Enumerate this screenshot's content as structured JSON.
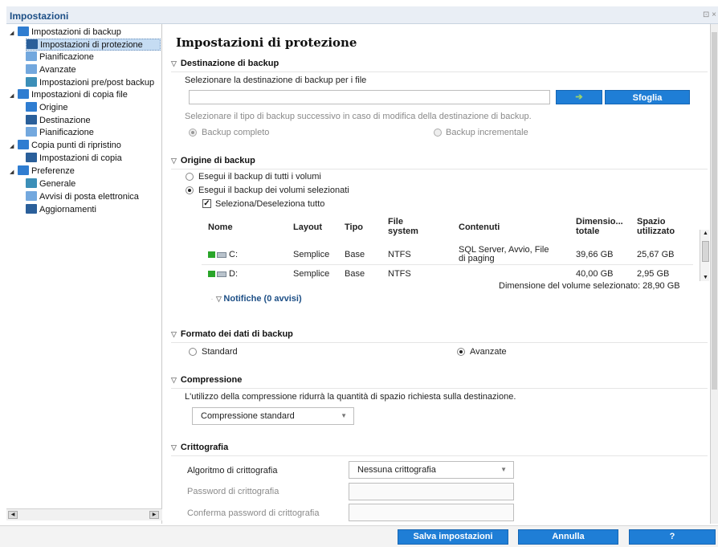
{
  "window": {
    "title": "Impostazioni",
    "controls": "⊡ ×"
  },
  "sidebar": {
    "items": [
      {
        "label": "Impostazioni di backup"
      },
      {
        "label": "Impostazioni di protezione"
      },
      {
        "label": "Pianificazione"
      },
      {
        "label": "Avanzate"
      },
      {
        "label": "Impostazioni pre/post backup"
      },
      {
        "label": "Impostazioni di copia file"
      },
      {
        "label": "Origine"
      },
      {
        "label": "Destinazione"
      },
      {
        "label": "Pianificazione"
      },
      {
        "label": "Copia punti di ripristino"
      },
      {
        "label": "Impostazioni di copia"
      },
      {
        "label": "Preferenze"
      },
      {
        "label": "Generale"
      },
      {
        "label": "Avvisi di posta elettronica"
      },
      {
        "label": "Aggiornamenti"
      }
    ]
  },
  "main": {
    "page_title": "Impostazioni di protezione",
    "destination": {
      "heading": "Destinazione di backup",
      "label": "Selezionare la destinazione di backup per i file",
      "value": "",
      "browse": "Sfoglia",
      "hint": "Selezionare il tipo di backup successivo in caso di modifica della destinazione di backup.",
      "full": "Backup completo",
      "incremental": "Backup incrementale"
    },
    "source": {
      "heading": "Origine di backup",
      "opt_all": "Esegui il backup di tutti i volumi",
      "opt_selected": "Esegui il backup dei volumi selezionati",
      "toggle_all": "Seleziona/Deseleziona tutto",
      "columns": [
        "Nome",
        "Layout",
        "Tipo",
        "File system",
        "Contenuti",
        "Dimensione totale",
        "Spazio utilizzato"
      ],
      "col_labels": {
        "nome": "Nome",
        "layout": "Layout",
        "tipo": "Tipo",
        "fs1": "File",
        "fs2": "system",
        "contenuti": "Contenuti",
        "dim1": "Dimensio...",
        "dim2": "totale",
        "spazio1": "Spazio",
        "spazio2": "utilizzato"
      },
      "rows": [
        {
          "name": "C:",
          "layout": "Semplice",
          "type": "Base",
          "fs": "NTFS",
          "content1": "SQL Server, Avvio, File",
          "content2": "di paging",
          "total": "39,66 GB",
          "used": "25,67 GB"
        },
        {
          "name": "D:",
          "layout": "Semplice",
          "type": "Base",
          "fs": "NTFS",
          "content1": "",
          "content2": "",
          "total": "40,00 GB",
          "used": "2,95 GB"
        }
      ],
      "selected_size": "Dimensione del volume selezionato: 28,90 GB",
      "notifications": "Notifiche (0 avvisi)"
    },
    "format": {
      "heading": "Formato dei dati di backup",
      "standard": "Standard",
      "advanced": "Avanzate"
    },
    "compression": {
      "heading": "Compressione",
      "desc": "L'utilizzo della compressione ridurrà la quantità di spazio richiesta sulla destinazione.",
      "selected": "Compressione standard"
    },
    "encryption": {
      "heading": "Crittografia",
      "algo_label": "Algoritmo di crittografia",
      "algo_value": "Nessuna crittografia",
      "password_label": "Password di crittografia",
      "confirm_label": "Conferma password di crittografia"
    }
  },
  "footer": {
    "save": "Salva impostazioni",
    "cancel": "Annulla",
    "help": "?"
  }
}
